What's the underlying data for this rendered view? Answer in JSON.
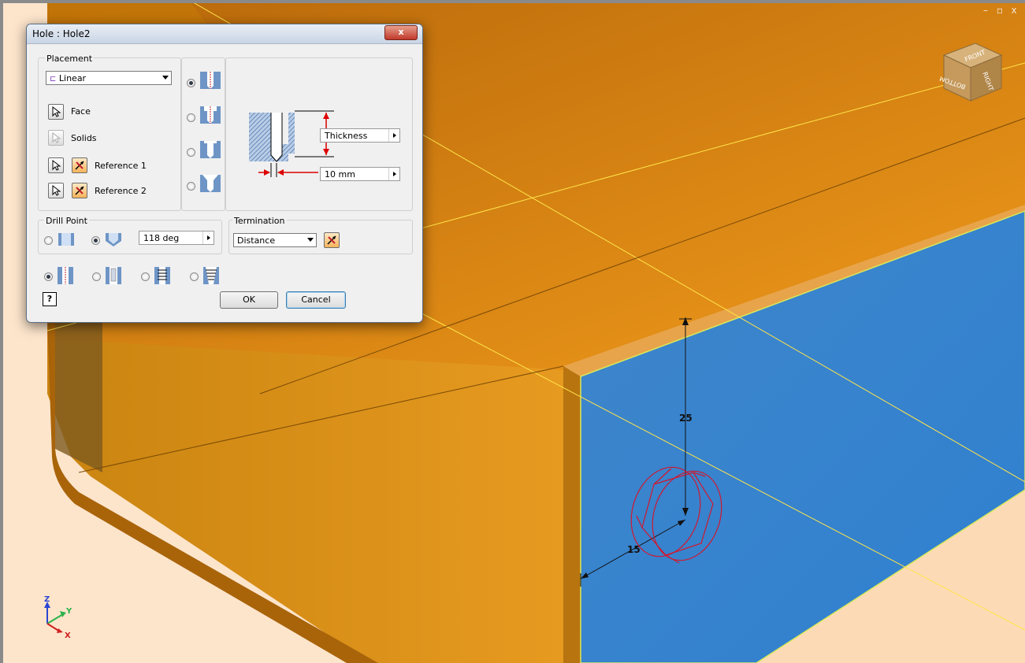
{
  "window_controls": {
    "minimize": "–",
    "restore": "▫",
    "close": "x"
  },
  "viewcube": {
    "top_face": "FRONT",
    "right_face": "RIGHT",
    "left_face": "BOTTOM"
  },
  "triad": {
    "z": "Z",
    "y": "Y",
    "x": "X"
  },
  "dimensions": {
    "vertical": "25",
    "horizontal": "15"
  },
  "dialog": {
    "title": "Hole : Hole2",
    "close_label": "x",
    "placement": {
      "group_title": "Placement",
      "type_value": "Linear",
      "face_label": "Face",
      "solids_label": "Solids",
      "reference1_label": "Reference 1",
      "reference2_label": "Reference 2"
    },
    "preview": {
      "thickness_value": "Thickness",
      "diameter_value": "10 mm"
    },
    "drill_point": {
      "group_title": "Drill Point",
      "angle_value": "118 deg"
    },
    "termination": {
      "group_title": "Termination",
      "value": "Distance"
    },
    "buttons": {
      "help": "?",
      "ok": "OK",
      "cancel": "Cancel"
    }
  },
  "colors": {
    "part_orange": "#e58a12",
    "face_blue": "#2f7fc9",
    "highlight_yellow": "#ffe44a",
    "hole_red": "#d0182f",
    "dialog_bg": "#f0f0f0",
    "frame_gray": "#8a8a8a"
  }
}
